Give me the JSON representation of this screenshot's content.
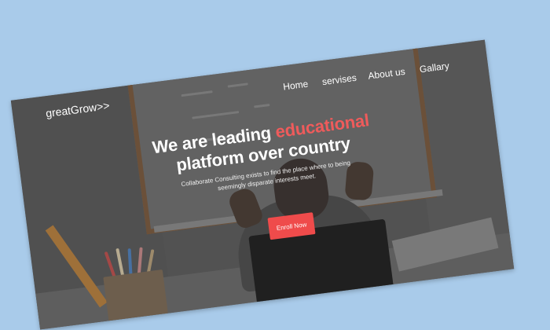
{
  "brand": {
    "logo_text": "greatGrow>>"
  },
  "nav": {
    "items": [
      {
        "label": "Home"
      },
      {
        "label": "servises"
      },
      {
        "label": "About us"
      },
      {
        "label": "Gallary"
      }
    ]
  },
  "hero": {
    "title_part1": "We are leading ",
    "title_accent": "educational",
    "title_part2": "platform over country",
    "subtitle": "Collaborate Consulting exists to find the place where to being seemingly disparate interests meet.",
    "cta_label": "Enroll Now"
  },
  "colors": {
    "page_background": "#a9cbea",
    "accent": "#ef5b5b",
    "button": "#ef4b4b"
  }
}
